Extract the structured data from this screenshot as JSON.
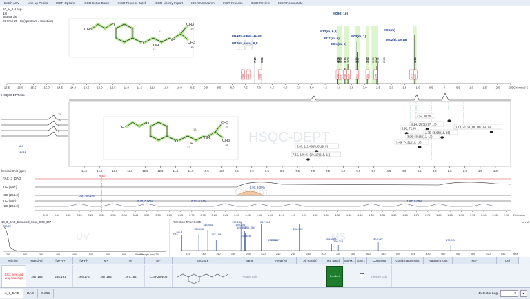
{
  "menu": [
    "Batch ASV",
    "Line up Peaks",
    "IXCR Options",
    "IXCR Setup Batch",
    "IXCR Process Batch",
    "IXCR Library Import",
    "IXCR MSSearch",
    "IXCR Process",
    "IXCR Review",
    "IXCR Reannotate"
  ],
  "h1_panel": {
    "title": "10_H_1H.esp",
    "line2": "1H",
    "solvent": "DMSO-d6",
    "info": "26 H's / 25 H's (spectrum / structure)",
    "watermark": "1H",
    "axis_label": "Chemical S",
    "ticks": [
      "16.5",
      "16.0",
      "15.5",
      "15.0",
      "14.5",
      "14.0",
      "13.5",
      "13.0",
      "12.5",
      "12.0",
      "11.5",
      "11.0",
      "10.5",
      "10.0",
      "9.5",
      "9.0",
      "8.5",
      "8.0",
      "7.5",
      "7.0",
      "6.5",
      "6.0",
      "5.5",
      "5.0",
      "4.5",
      "4.0",
      "3.5",
      "3.0",
      "2.5",
      "2.0",
      "1.5",
      "1.0",
      "0.5",
      "0",
      "-0.5",
      "-1.0",
      "-1.5",
      "-2.0",
      "-2.5"
    ],
    "assignments": [
      {
        "label": "M14(m,para), 11,15"
      },
      {
        "label": "M13(m,para), 9,8"
      },
      {
        "label": "M09(t, 16)"
      },
      {
        "label": "M12(m, 6,3)"
      },
      {
        "label": "M11(m, 6)"
      },
      {
        "label": "M03(m, 1)"
      },
      {
        "label": "M04(m, 5)"
      },
      {
        "label": "M02(d, 19,18)"
      },
      {
        "label": "M01(m)"
      }
    ],
    "peak_labels": [
      "7.15",
      "7.14",
      "6.89",
      "6.88",
      "4.02",
      "4.01",
      "4.00",
      "3.94",
      "3.92",
      "3.77",
      "3.73",
      "3.64",
      "3.32",
      "3.30",
      "3.27",
      "2.92",
      "2.90",
      "2.69",
      "2.60",
      "2.55",
      "2.52",
      "2.28",
      "1.12",
      "1.10"
    ],
    "integrals": [
      "2.84",
      "1.84",
      "1.06",
      "1.03",
      "0.97",
      "1.00",
      "2.12",
      "2.10",
      "3.01",
      "1.98",
      "5.72",
      "6.02"
    ],
    "structure": {
      "atoms": [
        "CH3",
        "O",
        "O",
        "OH",
        "NH",
        "CH3",
        "CH3"
      ],
      "numbers": [
        "12",
        "13",
        "19",
        "18"
      ]
    }
  },
  "hsqc_panel": {
    "title": "HSQCDEPT.esp",
    "watermark": "HSQC-DEPT",
    "axis_label": "hemical Shift (ppm)",
    "ticks": [
      "14.5",
      "14.0",
      "13.5",
      "13.0",
      "12.5",
      "12.0",
      "11.5",
      "11.0",
      "10.5",
      "10.0",
      "9.5",
      "9.0",
      "8.5",
      "8.0",
      "7.5",
      "7.0",
      "6.5",
      "6.0",
      "5.5",
      "5.0",
      "4.5",
      "4.0",
      "3.5",
      "3.0",
      "2.5",
      "2.0",
      "1.5",
      "1.0"
    ],
    "left_labels": [
      "11",
      "10",
      "9",
      "8",
      "8.9",
      "10.11"
    ],
    "cross_peaks": [
      {
        "label": "3.24, 58.52 (17, 17)"
      },
      {
        "label": "3.92, 72.40"
      },
      {
        "label": "2.52, 40.99"
      },
      {
        "label": "1.13, 21.69 (18, 18),(19, 19)"
      },
      {
        "label": "2.75, 55.58 (11, 15)"
      },
      {
        "label": "3.96, 50.16 (13, 13)"
      },
      {
        "label": "3.49, 74.21 (16, 16)"
      },
      {
        "label": "6.87, 115.46 (8, 8),(9, 9)"
      },
      {
        "label": "7.15, 130.91 (10, 10),(11, 11)"
      }
    ]
  },
  "chrom_panel": {
    "watermark": "Chrom",
    "traces": [
      {
        "name": "FAC_3_DAD"
      },
      {
        "name": "TIC (ES+)"
      },
      {
        "name": "XIC (268.2)"
      },
      {
        "name": "TIC (ES-)"
      },
      {
        "name": "XIC (266.2)"
      }
    ],
    "peak_labels": [
      "0.30",
      "0.97, 9.00%",
      "0.21, 0.01%",
      "0.47, 0.00%",
      "0.71, 0.01%",
      "1.67, 0.00%"
    ],
    "ticks": [
      "0.05",
      "0.10",
      "0.15",
      "0.20",
      "0.25",
      "0.30",
      "0.35",
      "0.40",
      "0.45",
      "0.50",
      "0.55",
      "0.60",
      "0.65",
      "0.70",
      "0.75",
      "0.80",
      "0.85",
      "0.90",
      "0.95",
      "1.00",
      "1.05",
      "1.10",
      "1.15",
      "1.20",
      "1.25",
      "1.30",
      "1.35",
      "1.40",
      "1.45",
      "1.50",
      "1.55",
      "1.60",
      "1.65",
      "1.70",
      "1.75",
      "1.80",
      "1.85",
      "1.90",
      "1.95",
      "2.00",
      "2.05",
      "2.10"
    ],
    "axis_label": "Retention"
  },
  "uv_panel": {
    "title": "10_3_DAD_Extracted_Scan_0.00_367",
    "watermark": "UV",
    "axis_label": "Wavelength (nm)",
    "ticks": [
      "250",
      "300",
      "350",
      "400",
      "450",
      "500",
      "550",
      "600",
      "650",
      "700"
    ],
    "max_label": "250.17"
  },
  "ms_panel": {
    "retention": "Retention Time: 0.365",
    "watermark": "MS",
    "esp_label": "ES+",
    "axis_label": "m/z",
    "right_label": "Ion M",
    "peaks": [
      "133.996",
      "145.964",
      "190.236",
      "195.001",
      "194.845",
      "196.154",
      "217.064",
      "157.168",
      "196.626",
      "232.760",
      "235.687",
      "268.082",
      "311.2660",
      "320.015",
      "373.327",
      "470.026",
      "111.5"
    ],
    "ticks": [
      "120",
      "140",
      "160",
      "180",
      "200",
      "220",
      "240",
      "260",
      "280",
      "300",
      "320",
      "340",
      "360",
      "380",
      "400",
      "420",
      "440",
      "460",
      "480",
      "500",
      "520",
      "540"
    ]
  },
  "results_table": {
    "headers": [
      "Rt(min)",
      "Mass(Av)",
      "[M+H]+",
      "[M-H]-",
      "M+",
      "M-",
      "MF",
      "Structure",
      "Name",
      "Area (%)",
      "All Rt(min)",
      "MS Match",
      "MS/M...",
      "Sho...",
      "Comment",
      "Confirmatory Ions",
      "Fragment Ions",
      "MS-",
      "Del"
    ],
    "drop_hint": "Click here and drag to assign",
    "row": {
      "mass_av": "267.183",
      "mh_plus": "268.191",
      "mh_minus": "266.176",
      "m_plus": "267.183",
      "m_minus": "267.184",
      "mf": "C15H25NO3",
      "name": "Please Edit",
      "ms_match": "Excellent",
      "comment": "Please Edit"
    }
  },
  "statusbar": {
    "left": "-A_3_DAD",
    "tab2": "DAD",
    "value": "0.365",
    "detector_label": "Detector Lag",
    "detector_value": "0"
  },
  "colors": {
    "accent": "#9be36b",
    "menu_bg": "#e8eef6",
    "ms_match": "#1e7d2d",
    "integral": "#c8232a",
    "assign": "#1a3d8f"
  }
}
